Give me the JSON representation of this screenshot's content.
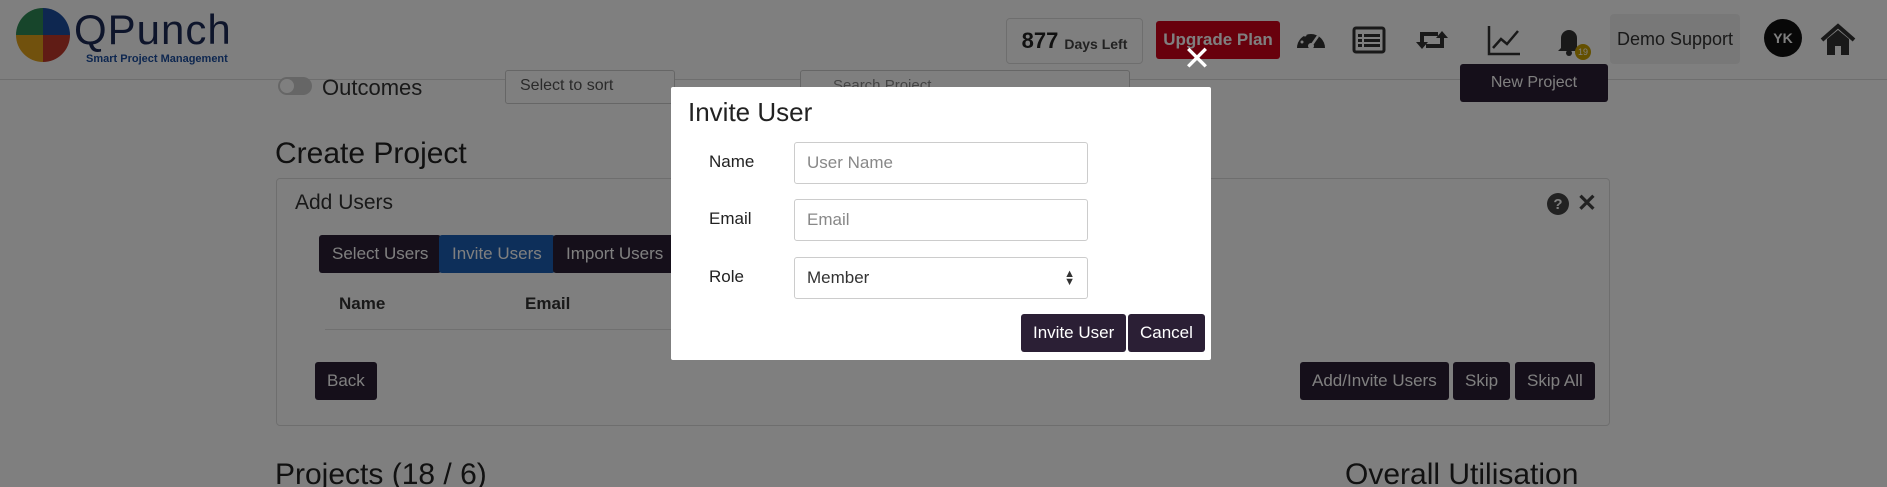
{
  "header": {
    "logo_text": "QPunch",
    "logo_tagline": "Smart Project Management",
    "days_left_number": "877",
    "days_left_label": "Days Left",
    "upgrade_label": "Upgrade Plan",
    "notification_count": "19",
    "support_label": "Demo Support",
    "avatar_initials": "YK",
    "brand_colors": {
      "navy": "#1d2a57",
      "red": "#d0021b",
      "dark": "#2b1f35"
    }
  },
  "filters": {
    "outcomes_label": "Outcomes",
    "sort_placeholder": "Select to sort",
    "search_placeholder": "Search Project",
    "new_project_label": "New Project"
  },
  "create_project": {
    "title": "Create Project",
    "panel_title": "Add Users",
    "tabs": [
      "Select Users",
      "Invite Users",
      "Import Users"
    ],
    "columns": [
      "Name",
      "Email"
    ],
    "back_label": "Back",
    "add_invite_label": "Add/Invite Users",
    "skip_label": "Skip",
    "skip_all_label": "Skip All"
  },
  "projects": {
    "title": "Projects (18 / 6)",
    "utilisation_title": "Overall Utilisation"
  },
  "modal": {
    "title": "Invite User",
    "name_label": "Name",
    "name_placeholder": "User Name",
    "email_label": "Email",
    "email_placeholder": "Email",
    "role_label": "Role",
    "role_value": "Member",
    "invite_label": "Invite User",
    "cancel_label": "Cancel"
  }
}
